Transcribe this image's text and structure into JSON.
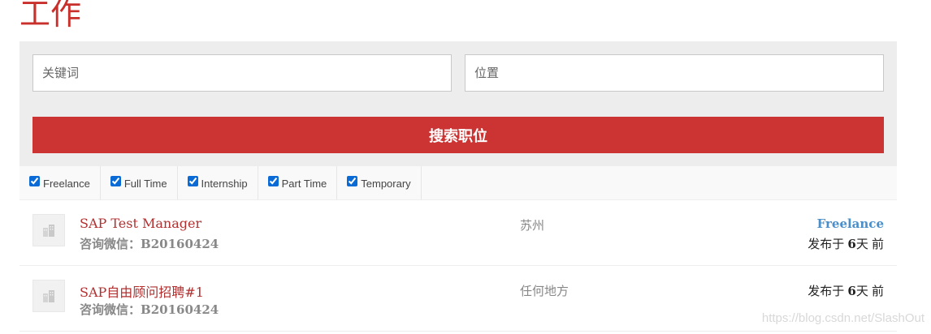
{
  "header": {
    "title": "工作"
  },
  "search": {
    "keyword_placeholder": "关键词",
    "location_placeholder": "位置",
    "button_label": "搜索职位",
    "button_color": "#cc3333"
  },
  "filters": [
    {
      "label": "Freelance",
      "checked": true
    },
    {
      "label": "Full Time",
      "checked": true
    },
    {
      "label": "Internship",
      "checked": true
    },
    {
      "label": "Part Time",
      "checked": true
    },
    {
      "label": "Temporary",
      "checked": true
    }
  ],
  "jobs": [
    {
      "title": "SAP Test Manager",
      "company_label": "咨询微信：",
      "company_id": "B20160424",
      "location": "苏州",
      "type": "Freelance",
      "date_prefix": "发布于 ",
      "date_num": "6",
      "date_suffix": "天 前"
    },
    {
      "title": "SAP自由顾问招聘#1",
      "company_label": "咨询微信：",
      "company_id": "B20160424",
      "location": "任何地方",
      "type": "",
      "date_prefix": "发布于 ",
      "date_num": "6",
      "date_suffix": "天 前"
    }
  ],
  "watermark": "https://blog.csdn.net/SlashOut"
}
